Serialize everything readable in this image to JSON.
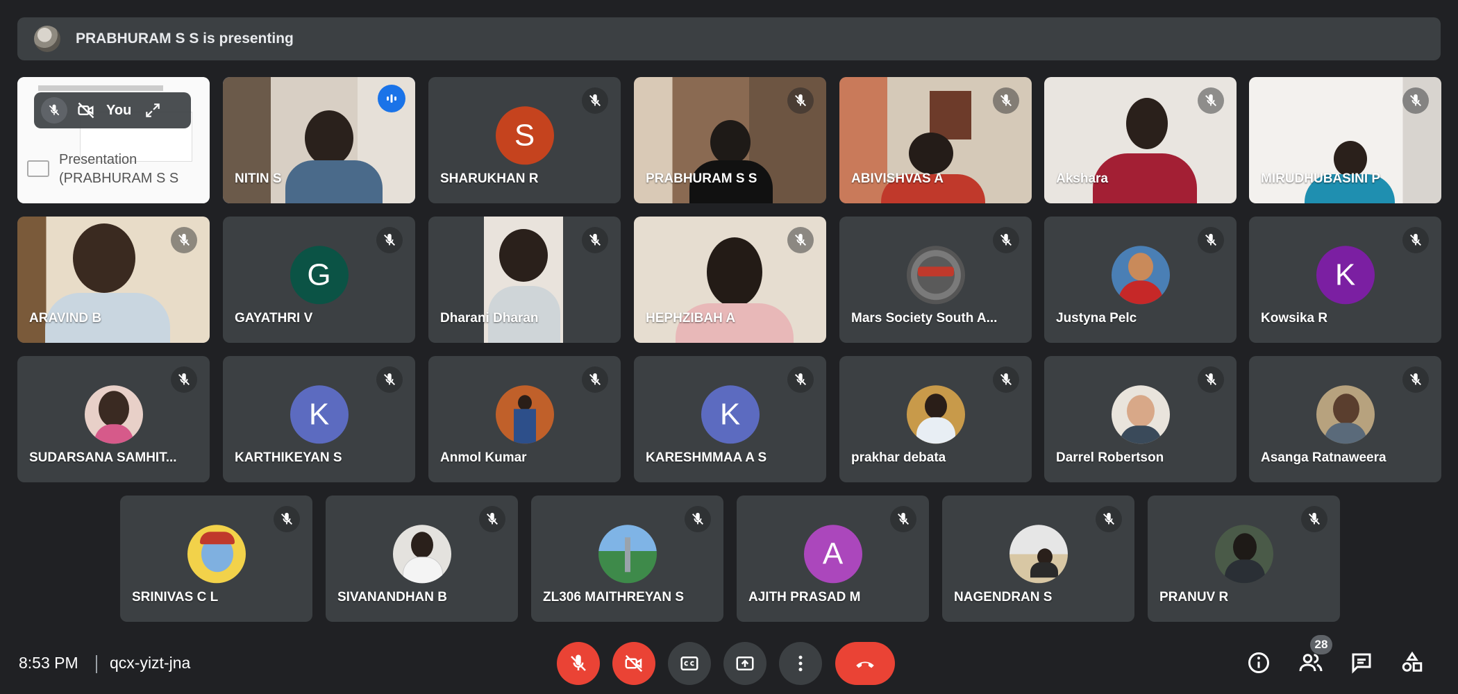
{
  "banner": {
    "text": "PRABHURAM S S is presenting"
  },
  "self_tile": {
    "you_label": "You",
    "presentation_line1": "Presentation",
    "presentation_line2": "(PRABHURAM S S"
  },
  "tiles": [
    {
      "name": "NITIN S",
      "kind": "video",
      "speaking": true
    },
    {
      "name": "SHARUKHAN R",
      "kind": "letter",
      "letter": "S",
      "color": "#c5431e"
    },
    {
      "name": "PRABHURAM S S",
      "kind": "video"
    },
    {
      "name": "ABIVISHVAS A",
      "kind": "video"
    },
    {
      "name": "Akshara",
      "kind": "video"
    },
    {
      "name": "MIRUDHUBASINI P",
      "kind": "video"
    },
    {
      "name": "ARAVIND B",
      "kind": "video"
    },
    {
      "name": "GAYATHRI V",
      "kind": "letter",
      "letter": "G",
      "color": "#0b5345"
    },
    {
      "name": "Dharani Dharan",
      "kind": "video"
    },
    {
      "name": "HEPHZIBAH A",
      "kind": "video"
    },
    {
      "name": "Mars Society South A...",
      "kind": "photo"
    },
    {
      "name": "Justyna Pelc",
      "kind": "photo"
    },
    {
      "name": "Kowsika R",
      "kind": "letter",
      "letter": "K",
      "color": "#7b1fa2"
    },
    {
      "name": "SUDARSANA SAMHIT...",
      "kind": "photo"
    },
    {
      "name": "KARTHIKEYAN S",
      "kind": "letter",
      "letter": "K",
      "color": "#5c6bc0"
    },
    {
      "name": "Anmol Kumar",
      "kind": "photo"
    },
    {
      "name": "KARESHMMAA A S",
      "kind": "letter",
      "letter": "K",
      "color": "#5c6bc0"
    },
    {
      "name": "prakhar debata",
      "kind": "photo"
    },
    {
      "name": "Darrel Robertson",
      "kind": "photo"
    },
    {
      "name": "Asanga Ratnaweera",
      "kind": "photo"
    },
    {
      "name": "SRINIVAS C L",
      "kind": "photo"
    },
    {
      "name": "SIVANANDHAN B",
      "kind": "photo"
    },
    {
      "name": "ZL306 MAITHREYAN S",
      "kind": "photo"
    },
    {
      "name": "AJITH PRASAD M",
      "kind": "letter",
      "letter": "A",
      "color": "#ab47bc"
    },
    {
      "name": "NAGENDRAN S",
      "kind": "photo"
    },
    {
      "name": "PRANUV R",
      "kind": "photo"
    }
  ],
  "bottom": {
    "time": "8:53 PM",
    "meeting_code": "qcx-yizt-jna",
    "participant_count": "28"
  },
  "colors": {
    "background": "#202124",
    "tile": "#3c4043",
    "danger": "#ea4335",
    "accent": "#8ab4f8"
  }
}
